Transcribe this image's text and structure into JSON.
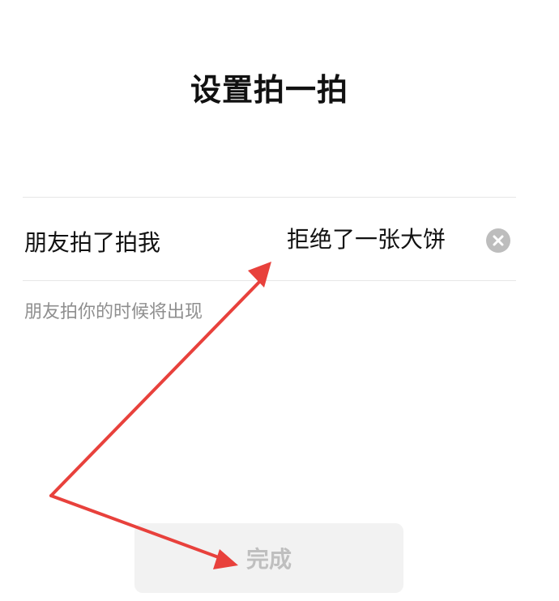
{
  "header": {
    "title": "设置拍一拍"
  },
  "pat_setting": {
    "label": "朋友拍了拍我",
    "suffix_value": "拒绝了一张大饼",
    "clear_icon": "clear-circle-icon",
    "hint": "朋友拍你的时候将出现"
  },
  "footer": {
    "done_label": "完成"
  },
  "annotation": {
    "arrow_color": "#e8413c"
  }
}
